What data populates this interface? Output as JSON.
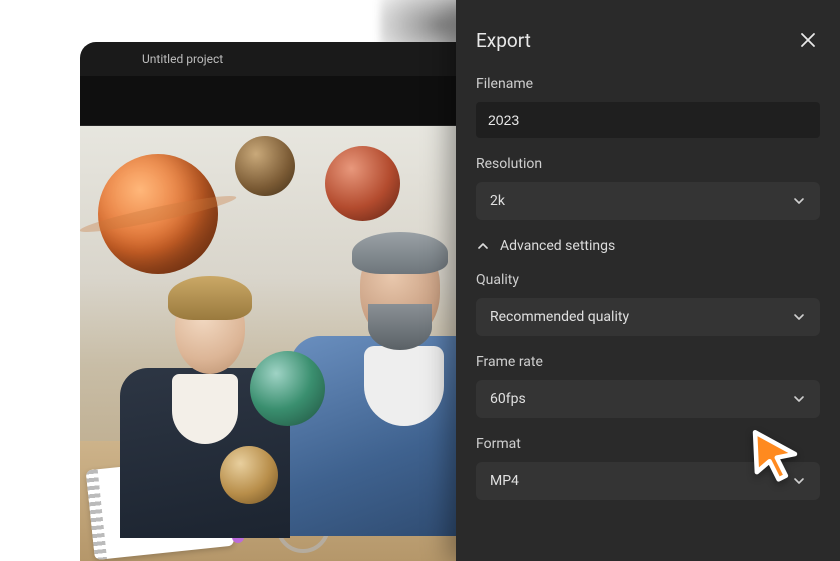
{
  "window": {
    "title": "Untitled project"
  },
  "export": {
    "title": "Export",
    "filename_label": "Filename",
    "filename_value": "2023",
    "resolution_label": "Resolution",
    "resolution_value": "2k",
    "advanced_label": "Advanced settings",
    "quality_label": "Quality",
    "quality_value": "Recommended quality",
    "framerate_label": "Frame rate",
    "framerate_value": "60fps",
    "format_label": "Format",
    "format_value": "MP4"
  }
}
